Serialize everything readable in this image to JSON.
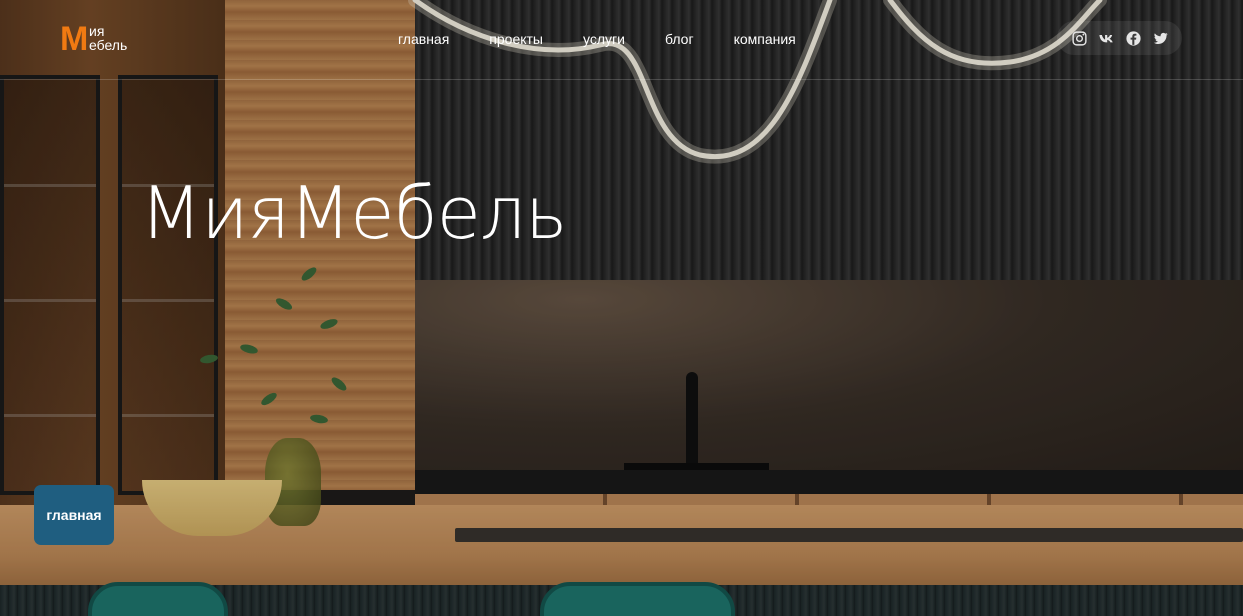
{
  "brand": {
    "logo_letter": "М",
    "logo_top": "ия",
    "logo_bottom": "ебель",
    "accent_color": "#f07a12"
  },
  "nav": {
    "items": [
      "главная",
      "проекты",
      "услуги",
      "блог",
      "компания"
    ]
  },
  "social": {
    "icons": [
      "instagram-icon",
      "vk-icon",
      "facebook-icon",
      "twitter-icon"
    ]
  },
  "hero": {
    "title": "МияМебель"
  },
  "floating_button": {
    "label": "главная",
    "color": "#1f5e80"
  }
}
